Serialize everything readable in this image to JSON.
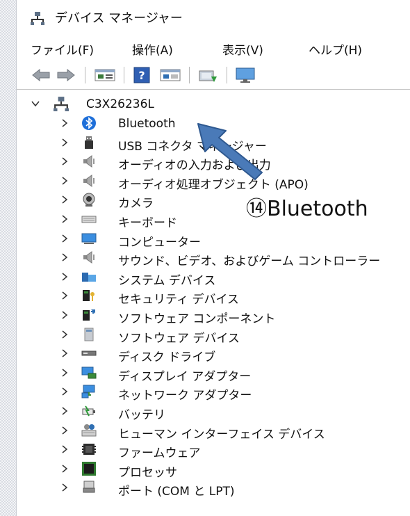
{
  "window": {
    "title": "デバイス マネージャー"
  },
  "menu": [
    "ファイル(F)",
    "操作(A)",
    "表示(V)",
    "ヘルプ(H)"
  ],
  "toolbar": {
    "buttons": [
      "back-icon",
      "forward-icon",
      "properties-icon",
      "help-icon",
      "view-icon",
      "update-driver-icon",
      "monitor-icon"
    ]
  },
  "tree": {
    "root": "C3X26236L",
    "items": [
      {
        "label": "Bluetooth",
        "icon": "bluetooth-icon"
      },
      {
        "label": "USB コネクタ マネージャー",
        "icon": "usb-icon"
      },
      {
        "label": "オーディオの入力および出力",
        "icon": "speaker-icon"
      },
      {
        "label": "オーディオ処理オブジェクト (APO)",
        "icon": "speaker-icon"
      },
      {
        "label": "カメラ",
        "icon": "camera-icon"
      },
      {
        "label": "キーボード",
        "icon": "keyboard-icon"
      },
      {
        "label": "コンピューター",
        "icon": "computer-icon"
      },
      {
        "label": "サウンド、ビデオ、およびゲーム コントローラー",
        "icon": "speaker-icon"
      },
      {
        "label": "システム デバイス",
        "icon": "system-folder-icon"
      },
      {
        "label": "セキュリティ デバイス",
        "icon": "security-device-icon"
      },
      {
        "label": "ソフトウェア コンポーネント",
        "icon": "software-component-icon"
      },
      {
        "label": "ソフトウェア デバイス",
        "icon": "software-device-icon"
      },
      {
        "label": "ディスク ドライブ",
        "icon": "disk-drive-icon"
      },
      {
        "label": "ディスプレイ アダプター",
        "icon": "display-adapter-icon"
      },
      {
        "label": "ネットワーク アダプター",
        "icon": "network-adapter-icon"
      },
      {
        "label": "バッテリ",
        "icon": "battery-icon"
      },
      {
        "label": "ヒューマン インターフェイス デバイス",
        "icon": "hid-icon"
      },
      {
        "label": "ファームウェア",
        "icon": "firmware-icon"
      },
      {
        "label": "プロセッサ",
        "icon": "processor-icon"
      },
      {
        "label": "ポート (COM と LPT)",
        "icon": "port-icon"
      }
    ]
  },
  "annotation": {
    "label": "⑭Bluetooth"
  },
  "colors": {
    "accent": "#4a7ab8",
    "bluetooth": "#1e6fd9"
  }
}
